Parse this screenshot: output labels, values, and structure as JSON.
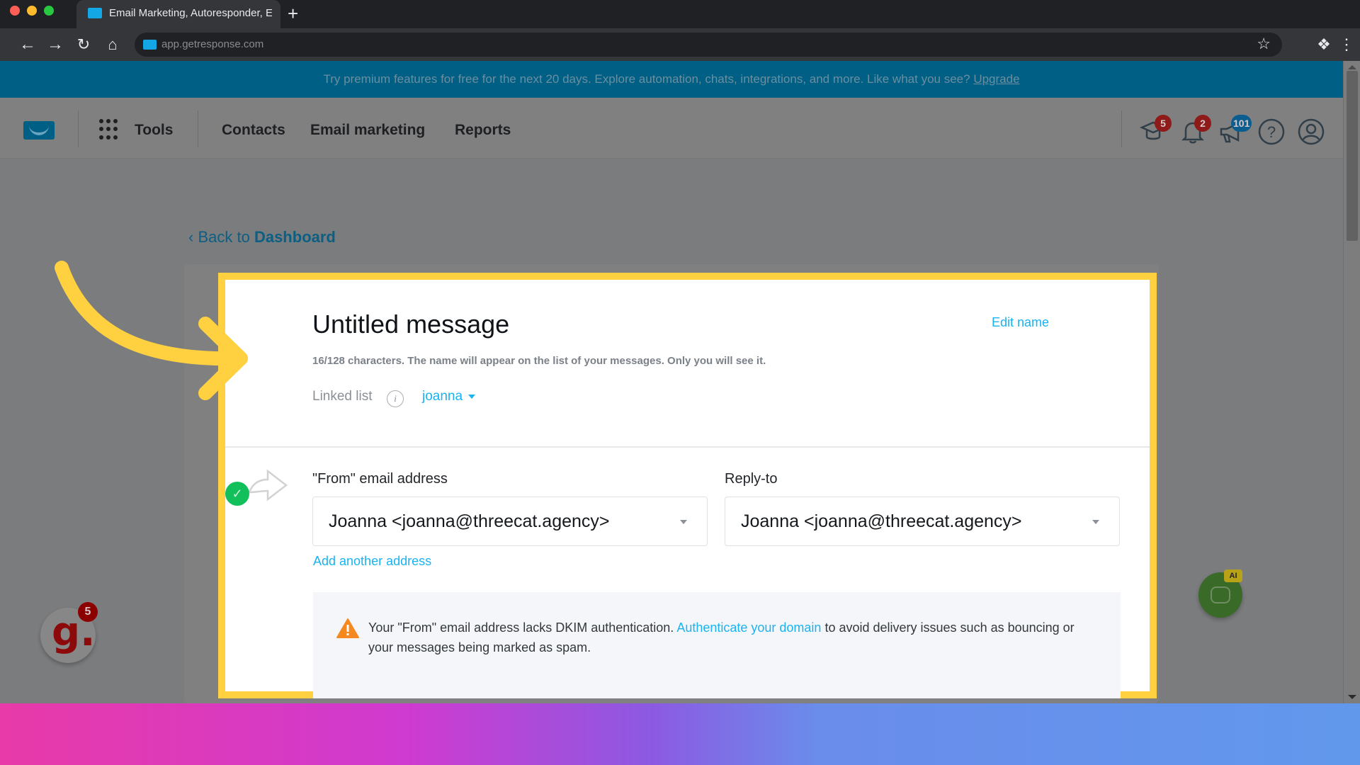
{
  "browser": {
    "tab_title": "Email Marketing, Autoresponder, E",
    "url": "app.getresponse.com",
    "new_tab_label": "+"
  },
  "promo_banner": {
    "text": "Try premium features for free for the next 20 days. Explore automation, chats, integrations, and more. Like what you see?",
    "link": "Upgrade"
  },
  "header": {
    "nav": [
      {
        "label": "Tools"
      },
      {
        "label": "Contacts"
      },
      {
        "label": "Email marketing"
      },
      {
        "label": "Reports"
      }
    ],
    "icons": [
      {
        "name": "academy-icon",
        "badge": "5",
        "badge_color": "#8e1a1a"
      },
      {
        "name": "notifications-icon",
        "badge": "2",
        "badge_color": "#8e1a1a"
      },
      {
        "name": "announcements-icon",
        "badge": "101",
        "badge_color": "#0b5d8f"
      },
      {
        "name": "help-icon"
      },
      {
        "name": "account-icon"
      }
    ]
  },
  "back_link": {
    "prefix": "Back to",
    "target": "Dashboard"
  },
  "message": {
    "title": "Untitled message",
    "edit_name": "Edit name",
    "char_hint": "16/128 characters. The name will appear on the list of your messages. Only you will see it.",
    "linked_list_label": "Linked list",
    "linked_list_info": "i",
    "linked_list_value": "joanna"
  },
  "sender": {
    "from_label": "\"From\" email address",
    "from_value": "Joanna <joanna@threecat.agency>",
    "reply_label": "Reply-to",
    "reply_value": "Joanna <joanna@threecat.agency>",
    "add_address": "Add another address"
  },
  "warning": {
    "text_before": "Your \"From\" email address lacks DKIM authentication.",
    "link": "Authenticate your domain",
    "text_after": "to avoid delivery issues such as bouncing or your messages being marked as spam."
  },
  "widgets": {
    "g_letter": "g.",
    "g_badge": "5",
    "ai_badge": "AI"
  },
  "colors": {
    "highlight": "#ffd140",
    "link": "#1ab3f0",
    "success": "#12c05b",
    "warning": "#f5891f",
    "promo_bg": "#005f84"
  }
}
